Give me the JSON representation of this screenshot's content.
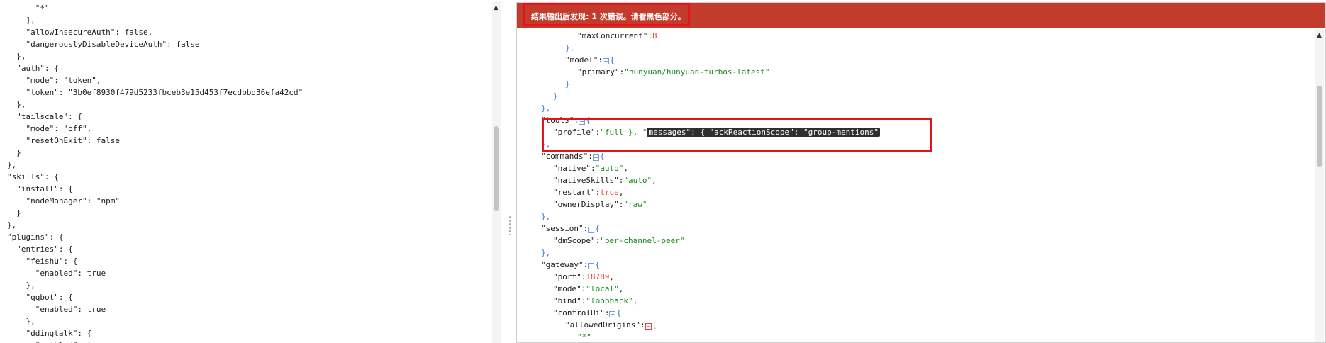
{
  "left_editor": {
    "lines": [
      "      \"*\"",
      "    ],",
      "    \"allowInsecureAuth\": false,",
      "    \"dangerouslyDisableDeviceAuth\": false",
      "  },",
      "  \"auth\": {",
      "    \"mode\": \"token\",",
      "    \"token\": \"3b0ef8930f479d5233fbceb3e15d453f7ecdbbd36efa42cd\"",
      "  },",
      "  \"tailscale\": {",
      "    \"mode\": \"off\",",
      "    \"resetOnExit\": false",
      "  }",
      "},",
      "\"skills\": {",
      "  \"install\": {",
      "    \"nodeManager\": \"npm\"",
      "  }",
      "},",
      "\"plugins\": {",
      "  \"entries\": {",
      "    \"feishu\": {",
      "      \"enabled\": true",
      "    },",
      "    \"qqbot\": {",
      "      \"enabled\": true",
      "    },",
      "    \"ddingtalk\": {",
      "      \"enabled\": true"
    ]
  },
  "result_panel": {
    "error_message": "结果输出后发现: 1 次错误。请看黑色部分。",
    "error_color": "#c23b2b",
    "highlight_color": "#e3141e",
    "toggle_collapse_symbol": "−",
    "lines": [
      {
        "indent": 5,
        "parts": [
          {
            "t": "\"maxConcurrent\"",
            "c": "k"
          },
          {
            "t": ":",
            "c": "k"
          },
          {
            "t": "8",
            "c": "n"
          }
        ]
      },
      {
        "indent": 4,
        "parts": [
          {
            "t": "},",
            "c": "b"
          }
        ]
      },
      {
        "indent": 4,
        "parts": [
          {
            "t": "\"model\"",
            "c": "k"
          },
          {
            "t": ":",
            "c": "k"
          },
          {
            "t": "",
            "c": "toggle"
          },
          {
            "t": "{",
            "c": "b"
          }
        ]
      },
      {
        "indent": 5,
        "parts": [
          {
            "t": "\"primary\"",
            "c": "k"
          },
          {
            "t": ":",
            "c": "k"
          },
          {
            "t": "\"hunyuan/hunyuan-turbos-latest\"",
            "c": "s"
          }
        ]
      },
      {
        "indent": 4,
        "parts": [
          {
            "t": "}",
            "c": "b"
          }
        ]
      },
      {
        "indent": 3,
        "parts": [
          {
            "t": "}",
            "c": "b"
          }
        ]
      },
      {
        "indent": 2,
        "parts": [
          {
            "t": "},",
            "c": "b"
          }
        ]
      },
      {
        "indent": 2,
        "parts": [
          {
            "t": "\"tools\"",
            "c": "k"
          },
          {
            "t": ":",
            "c": "k"
          },
          {
            "t": "",
            "c": "toggle"
          },
          {
            "t": "{",
            "c": "b"
          }
        ]
      },
      {
        "indent": 3,
        "parts": [
          {
            "t": "\"profile\"",
            "c": "k"
          },
          {
            "t": ":",
            "c": "k"
          },
          {
            "t": "\"full }, \"",
            "c": "s"
          },
          {
            "t": "messages\": { \"ackReactionScope\": \"group-mentions\"",
            "c": "err"
          }
        ]
      },
      {
        "indent": 2,
        "parts": [
          {
            "t": "},",
            "c": "b"
          }
        ]
      },
      {
        "indent": 2,
        "parts": [
          {
            "t": "\"commands\"",
            "c": "k"
          },
          {
            "t": ":",
            "c": "k"
          },
          {
            "t": "",
            "c": "toggle"
          },
          {
            "t": "{",
            "c": "b"
          }
        ]
      },
      {
        "indent": 3,
        "parts": [
          {
            "t": "\"native\"",
            "c": "k"
          },
          {
            "t": ":",
            "c": "k"
          },
          {
            "t": "\"auto\"",
            "c": "s"
          },
          {
            "t": ",",
            "c": "k"
          }
        ]
      },
      {
        "indent": 3,
        "parts": [
          {
            "t": "\"nativeSkills\"",
            "c": "k"
          },
          {
            "t": ":",
            "c": "k"
          },
          {
            "t": "\"auto\"",
            "c": "s"
          },
          {
            "t": ",",
            "c": "k"
          }
        ]
      },
      {
        "indent": 3,
        "parts": [
          {
            "t": "\"restart\"",
            "c": "k"
          },
          {
            "t": ":",
            "c": "k"
          },
          {
            "t": "true",
            "c": "n"
          },
          {
            "t": ",",
            "c": "k"
          }
        ]
      },
      {
        "indent": 3,
        "parts": [
          {
            "t": "\"ownerDisplay\"",
            "c": "k"
          },
          {
            "t": ":",
            "c": "k"
          },
          {
            "t": "\"raw\"",
            "c": "s"
          }
        ]
      },
      {
        "indent": 2,
        "parts": [
          {
            "t": "},",
            "c": "b"
          }
        ]
      },
      {
        "indent": 2,
        "parts": [
          {
            "t": "\"session\"",
            "c": "k"
          },
          {
            "t": ":",
            "c": "k"
          },
          {
            "t": "",
            "c": "toggle"
          },
          {
            "t": "{",
            "c": "b"
          }
        ]
      },
      {
        "indent": 3,
        "parts": [
          {
            "t": "\"dmScope\"",
            "c": "k"
          },
          {
            "t": ":",
            "c": "k"
          },
          {
            "t": "\"per-channel-peer\"",
            "c": "s"
          }
        ]
      },
      {
        "indent": 2,
        "parts": [
          {
            "t": "},",
            "c": "b"
          }
        ]
      },
      {
        "indent": 2,
        "parts": [
          {
            "t": "\"gateway\"",
            "c": "k"
          },
          {
            "t": ":",
            "c": "k"
          },
          {
            "t": "",
            "c": "toggle"
          },
          {
            "t": "{",
            "c": "b"
          }
        ]
      },
      {
        "indent": 3,
        "parts": [
          {
            "t": "\"port\"",
            "c": "k"
          },
          {
            "t": ":",
            "c": "k"
          },
          {
            "t": "18789",
            "c": "n"
          },
          {
            "t": ",",
            "c": "k"
          }
        ]
      },
      {
        "indent": 3,
        "parts": [
          {
            "t": "\"mode\"",
            "c": "k"
          },
          {
            "t": ":",
            "c": "k"
          },
          {
            "t": "\"local\"",
            "c": "s"
          },
          {
            "t": ",",
            "c": "k"
          }
        ]
      },
      {
        "indent": 3,
        "parts": [
          {
            "t": "\"bind\"",
            "c": "k"
          },
          {
            "t": ":",
            "c": "k"
          },
          {
            "t": "\"loopback\"",
            "c": "s"
          },
          {
            "t": ",",
            "c": "k"
          }
        ]
      },
      {
        "indent": 3,
        "parts": [
          {
            "t": "\"controlUi\"",
            "c": "k"
          },
          {
            "t": ":",
            "c": "k"
          },
          {
            "t": "",
            "c": "toggle"
          },
          {
            "t": "{",
            "c": "b"
          }
        ]
      },
      {
        "indent": 4,
        "parts": [
          {
            "t": "\"allowedOrigins\"",
            "c": "k"
          },
          {
            "t": ":",
            "c": "k"
          },
          {
            "t": "",
            "c": "toggle-red"
          },
          {
            "t": "[",
            "c": "n"
          }
        ]
      },
      {
        "indent": 5,
        "parts": [
          {
            "t": "\"*\"",
            "c": "s"
          }
        ]
      }
    ]
  }
}
